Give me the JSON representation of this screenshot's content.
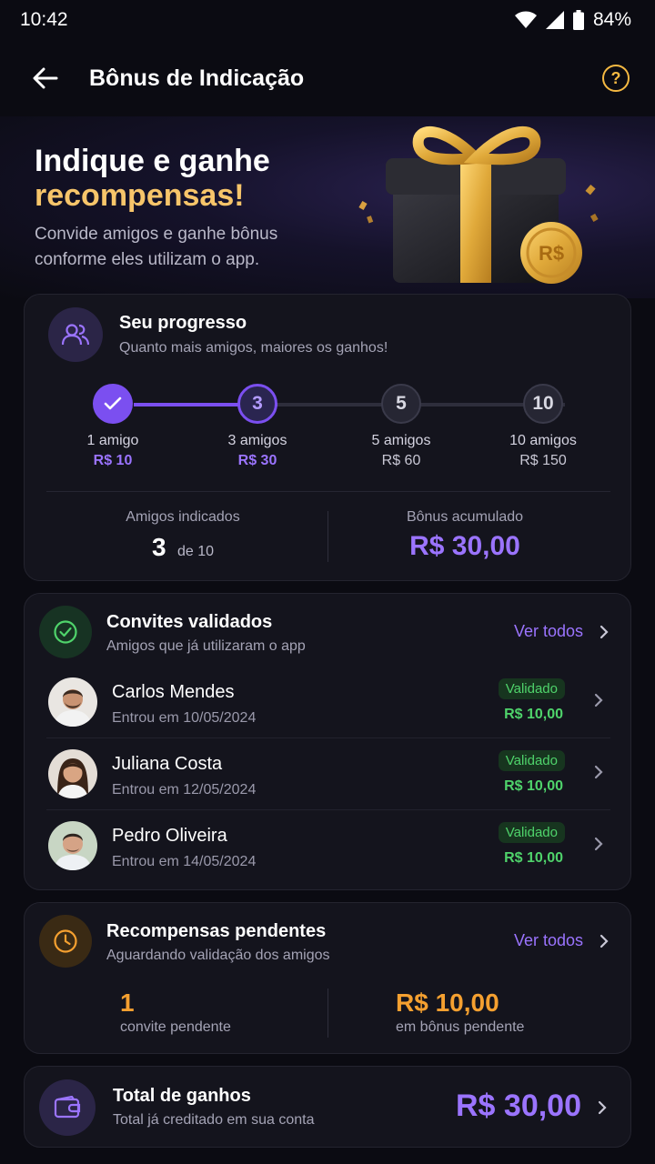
{
  "status": {
    "time": "10:42",
    "battery": "84%"
  },
  "appbar": {
    "title": "Bônus de Indicação"
  },
  "hero": {
    "title_line1": "Indique e ganhe",
    "title_line2": "recompensas!",
    "subtitle": "Convide amigos e ganhe bônus conforme eles utilizam o app.",
    "coin_label": "R$"
  },
  "progress": {
    "title": "Seu progresso",
    "subtitle": "Quanto mais amigos, maiores os ganhos!",
    "steps": [
      {
        "node": "",
        "label": "1 amigo",
        "reward": "R$ 10",
        "state": "done"
      },
      {
        "node": "3",
        "label": "3 amigos",
        "reward": "R$ 30",
        "state": "current"
      },
      {
        "node": "5",
        "label": "5 amigos",
        "reward": "R$ 60",
        "state": "todo"
      },
      {
        "node": "10",
        "label": "10 amigos",
        "reward": "R$ 150",
        "state": "todo"
      }
    ],
    "friends_label": "Amigos indicados",
    "friends_count": "3",
    "friends_total": "de 10",
    "bonus_label": "Bônus acumulado",
    "bonus_value": "R$ 30,00"
  },
  "validated": {
    "title": "Convites validados",
    "subtitle": "Amigos que já utilizaram o app",
    "see_all": "Ver todos",
    "friends": [
      {
        "name": "Carlos Mendes",
        "date": "Entrou em 10/05/2024",
        "badge": "Validado",
        "amount": "R$ 10,00"
      },
      {
        "name": "Juliana Costa",
        "date": "Entrou em 12/05/2024",
        "badge": "Validado",
        "amount": "R$ 10,00"
      },
      {
        "name": "Pedro Oliveira",
        "date": "Entrou em 14/05/2024",
        "badge": "Validado",
        "amount": "R$ 10,00"
      }
    ]
  },
  "pending": {
    "title": "Recompensas pendentes",
    "subtitle": "Aguardando validação dos amigos",
    "see_all": "Ver todos",
    "count": "1",
    "count_label": "convite pendente",
    "amount": "R$ 10,00",
    "amount_label": "em bônus pendente"
  },
  "total": {
    "title": "Total de ganhos",
    "subtitle": "Total já creditado em sua conta",
    "amount": "R$ 30,00"
  },
  "colors": {
    "background": "#0b0b12",
    "card": "#14141d",
    "purple": "#7b4ff0",
    "purple_text": "#9b74ff",
    "gold": "#f7c56a",
    "orange": "#f5a030",
    "green": "#4fd36b"
  }
}
